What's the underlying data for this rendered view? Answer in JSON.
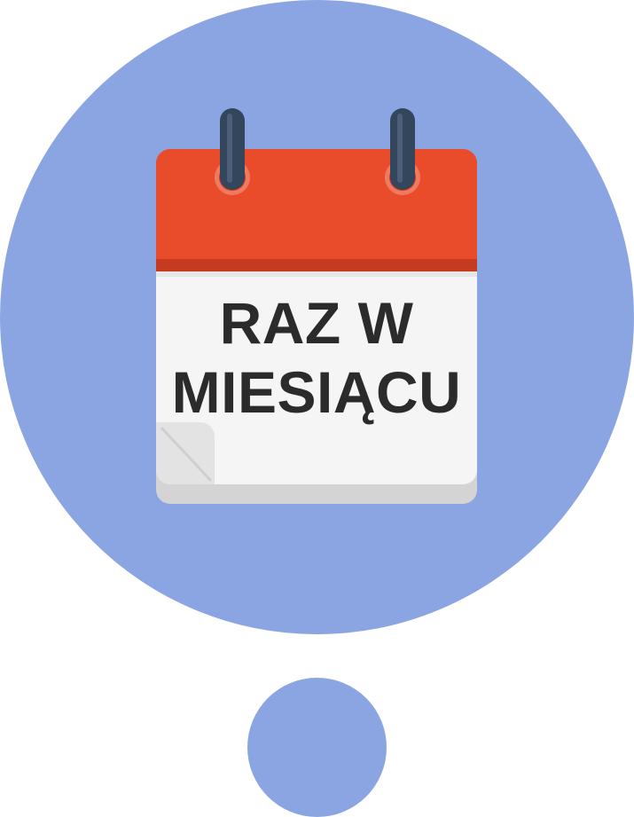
{
  "colors": {
    "background": "#ffffff",
    "circle": "#8aa5e2",
    "calendar_header": "#e84c2a",
    "calendar_header_stripe": "#c63a20",
    "calendar_body": "#f5f5f5",
    "calendar_base": "#d4d4d4",
    "ring": "#34465c",
    "text": "#2b2b2b"
  },
  "calendar": {
    "line1": "RAZ W",
    "line2": "MIESIĄCU"
  }
}
